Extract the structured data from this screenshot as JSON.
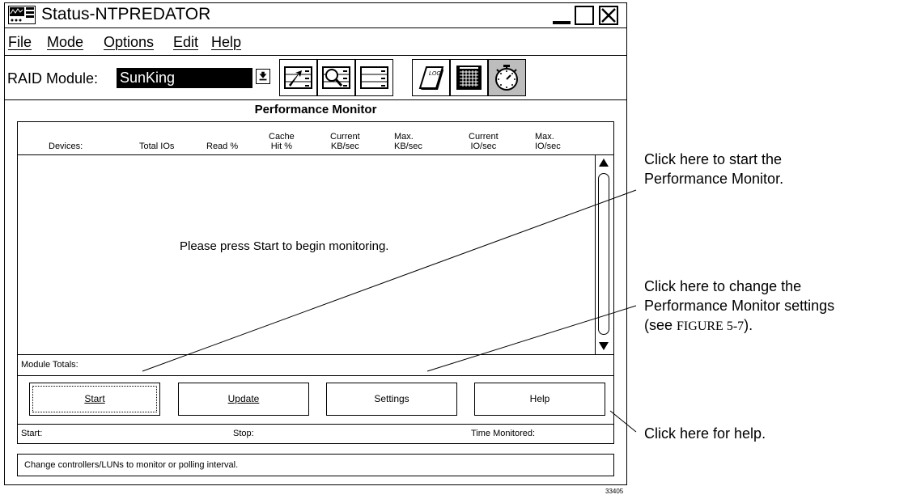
{
  "window": {
    "title": "Status-NTPREDATOR"
  },
  "menu": [
    "File",
    "Mode",
    "Options",
    "Edit",
    "Help"
  ],
  "toolbar": {
    "raid_label": "RAID Module:",
    "raid_value": "SunKing",
    "tool_icons": [
      "module-select-icon",
      "module-profile-icon",
      "lun-info-icon",
      "log-icon",
      "performance-grid-icon",
      "stopwatch-icon"
    ],
    "log_icon_text": "LOG"
  },
  "panel": {
    "title": "Performance Monitor",
    "columns": [
      "Devices:",
      "Total IOs",
      "Read %",
      "Cache\nHit %",
      "Current\nKB/sec",
      "Max.\nKB/sec",
      "Current\nIO/sec",
      "Max.\nIO/sec"
    ],
    "empty_message": "Please press Start to begin monitoring.",
    "totals_label": "Module Totals:"
  },
  "buttons": {
    "start": "Start",
    "update": "Update",
    "settings": "Settings",
    "help": "Help"
  },
  "info": {
    "start": "Start:",
    "stop": "Stop:",
    "time_monitored": "Time Monitored:"
  },
  "status_bar": "Change controllers/LUNs to monitor or polling interval.",
  "figure_number": "33405",
  "callouts": {
    "start": "Click here to start the\nPerformance Monitor.",
    "settings": "Click here to change the\nPerformance Monitor settings\n(see ",
    "settings_ref": "FIGURE 5-7",
    "settings_end": ").",
    "help": "Click here for help."
  }
}
